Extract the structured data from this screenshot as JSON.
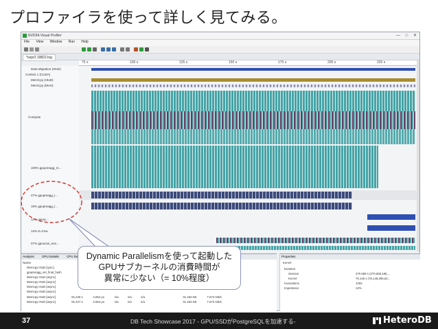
{
  "slide": {
    "title": "プロファイラを使って詳しく見てみる。",
    "page_number": "37",
    "footer_text": "DB Tech Showcase 2017 - GPU/SSDがPostgreSQLを加速する-",
    "logo_text": "HeteroDB"
  },
  "window": {
    "title": "NVIDIA Visual Profiler",
    "menu": [
      "File",
      "View",
      "Window",
      "Run",
      "Help"
    ],
    "tab_label": "*expr2.19822.log",
    "controls": [
      "—",
      "□",
      "✕"
    ]
  },
  "timeline": {
    "ticks": [
      "75 s",
      "100 s",
      "125 s",
      "150 s",
      "175 s",
      "200 s",
      "225 s"
    ],
    "rows": [
      {
        "label": "Data Migration (HtoD)"
      },
      {
        "label": "Context 1 (CUDA)"
      },
      {
        "label": "MemCpy (HtoD)"
      },
      {
        "label": "MemCpy (DtoH)"
      },
      {
        "label": "Compute"
      },
      {
        "label": "100% gpupreagg_m..."
      },
      {
        "label": "47% gpupreagg_l..."
      },
      {
        "label": "19% gpupreagg_l..."
      },
      {
        "label": "14% gpusc..."
      },
      {
        "label": "12% 8=1%a"
      },
      {
        "label": "07% gpuscan_exe..."
      }
    ]
  },
  "details": {
    "tabs": [
      "Analysis",
      "GPU Details",
      "CPU Details",
      "OpenACC Details",
      "Console",
      "Settings"
    ],
    "columns": [
      "Name"
    ],
    "rows": [
      {
        "name": "Memcpy HtoD [sync]",
        "c1": "",
        "c2": "",
        "c3": "",
        "c4": "",
        "c5": "",
        "c6": "",
        "c7": ""
      },
      {
        "name": "gpupreagg_set_final_hash",
        "c1": "",
        "c2": "",
        "c3": "",
        "c4": "",
        "c5": "",
        "c6": "",
        "c7": ""
      },
      {
        "name": "Memcpy HtoD [async]",
        "c1": "",
        "c2": "",
        "c3": "",
        "c4": "",
        "c5": "",
        "c6": "",
        "c7": ""
      },
      {
        "name": "Memcpy HtoD [async]",
        "c1": "",
        "c2": "",
        "c3": "",
        "c4": "",
        "c5": "",
        "c6": "",
        "c7": ""
      },
      {
        "name": "Memcpy HtoD [async]",
        "c1": "",
        "c2": "",
        "c3": "",
        "c4": "",
        "c5": "",
        "c6": "",
        "c7": ""
      },
      {
        "name": "Memcpy HtoD [async]",
        "c1": "",
        "c2": "",
        "c3": "",
        "c4": "",
        "c5": "",
        "c6": "",
        "c7": ""
      },
      {
        "name": "Memcpy HtoD [async]",
        "c1": "81.225 s",
        "c2": "4.064 μs",
        "c3": "n/a",
        "c4": "n/a",
        "c5": "n/a",
        "c6": "31.184 KB",
        "c7": "7.673 GB/s"
      },
      {
        "name": "Memcpy HtoD [async]",
        "c1": "81.227 s",
        "c2": "4.064 μs",
        "c3": "n/a",
        "c4": "n/a",
        "c5": "n/a",
        "c6": "31.184 KB",
        "c7": "7.673 GB/s"
      }
    ]
  },
  "properties": {
    "tab": "Properties",
    "header": "Kernel",
    "rows": [
      {
        "key": "Duration",
        "value": ""
      },
      {
        "key": "Session",
        "value": "270.659 s (270,658,188,..."
      },
      {
        "key": "Kernel",
        "value": "76.146 s (76,146,295,54..."
      },
      {
        "key": "Invocations",
        "value": "1402"
      },
      {
        "key": "Importance",
        "value": "12%"
      }
    ]
  },
  "callout": {
    "line1": "Dynamic Parallelismを使って起動した",
    "line2": "GPUサブカーネルの消費時間が",
    "line3": "異常に少ない（= 10%程度）"
  },
  "colors": {
    "accent_red": "#d43a2f",
    "teal": "#46a3a6",
    "navy": "#2f4fb2",
    "olive": "#a88f2e",
    "footer_bg": "#1a1a1a"
  }
}
